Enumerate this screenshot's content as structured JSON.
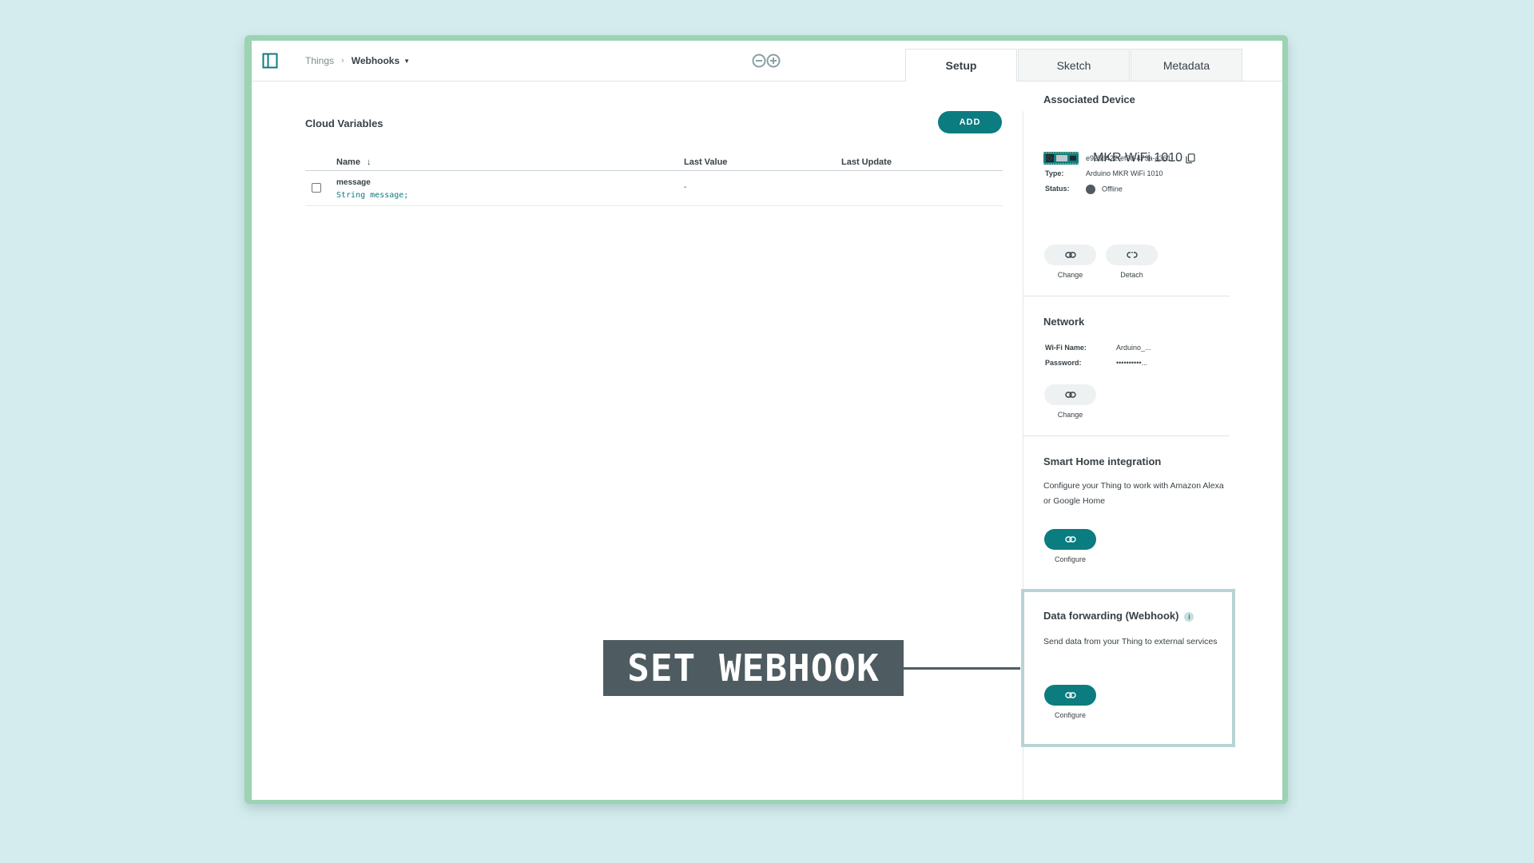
{
  "header": {
    "breadcrumb_root": "Things",
    "breadcrumb_current": "Webhooks",
    "tabs": [
      {
        "label": "Setup",
        "active": true
      },
      {
        "label": "Sketch",
        "active": false
      },
      {
        "label": "Metadata",
        "active": false
      }
    ]
  },
  "cloud_variables": {
    "title": "Cloud Variables",
    "add_label": "ADD",
    "columns": {
      "name": "Name",
      "last_value": "Last Value",
      "last_update": "Last Update"
    },
    "rows": [
      {
        "name": "message",
        "declaration": "String message;",
        "last_value": "-",
        "last_update": ""
      }
    ]
  },
  "associated_device": {
    "title": "Associated Device",
    "device_name": "MKR WiFi 1010",
    "id_label": "ID:",
    "id_value": "e9256422-ef9d-473a-a361-...",
    "type_label": "Type:",
    "type_value": "Arduino MKR WiFi 1010",
    "status_label": "Status:",
    "status_value": "Offline",
    "change_label": "Change",
    "detach_label": "Detach"
  },
  "network": {
    "title": "Network",
    "wifi_label": "Wi-Fi Name:",
    "wifi_value": "Arduino_...",
    "password_label": "Password:",
    "password_value": "••••••••••...",
    "change_label": "Change"
  },
  "smart_home": {
    "title": "Smart Home integration",
    "description": "Configure your Thing to work with Amazon Alexa or Google Home",
    "configure_label": "Configure"
  },
  "data_forwarding": {
    "title": "Data forwarding (Webhook)",
    "info_icon": "i",
    "description": "Send data from your Thing to external services",
    "configure_label": "Configure"
  },
  "overlay": {
    "banner_text": "SET WEBHOOK"
  },
  "colors": {
    "accent": "#0b7c80",
    "banner": "#4e5c61",
    "background": "#d5ecee",
    "frame": "#9cd3b3",
    "highlight": "#b8d3d3"
  },
  "icons": [
    "sidebar-toggle-icon",
    "arduino-logo-icon",
    "sort-down-icon",
    "copy-icon",
    "link-icon",
    "unlink-icon",
    "info-icon"
  ]
}
